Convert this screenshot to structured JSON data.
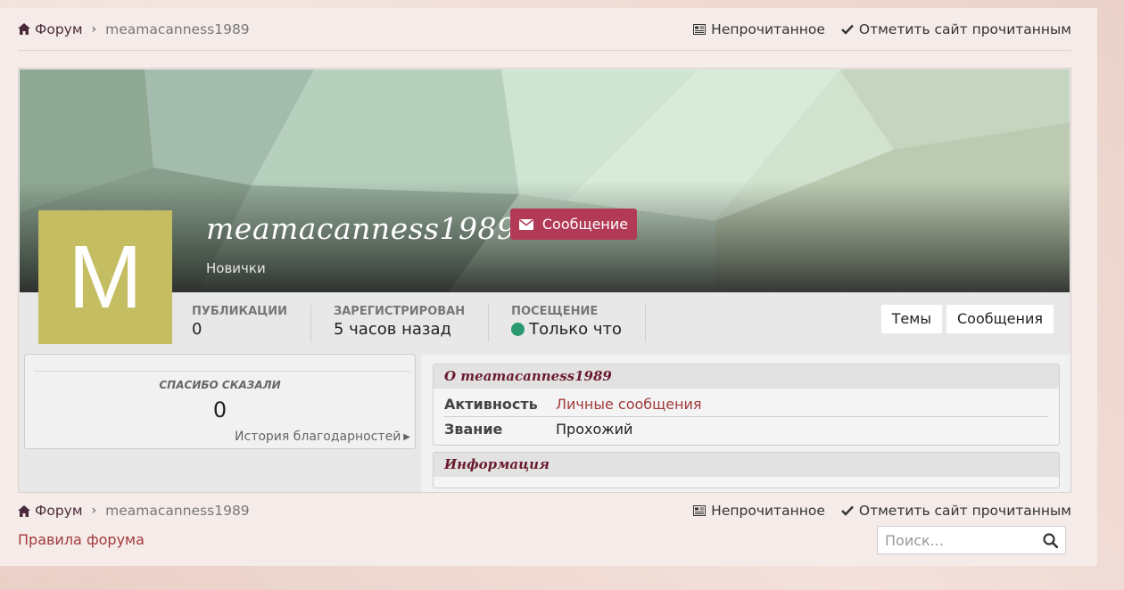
{
  "breadcrumb": {
    "home": "Форум",
    "current": "meamacanness1989"
  },
  "links": {
    "unread": "Непрочитанное",
    "mark_read": "Отметить сайт прочитанным"
  },
  "profile": {
    "avatar_letter": "M",
    "avatar_color": "#c4bd62",
    "username": "meamacanness1989",
    "group": "Новички",
    "message_button": "Сообщение",
    "stats": [
      {
        "label": "Публикации",
        "value": "0"
      },
      {
        "label": "Зарегистрирован",
        "value": "5 часов назад"
      },
      {
        "label": "Посещение",
        "value": "Только что"
      }
    ],
    "tabs": [
      "Темы",
      "Сообщения"
    ]
  },
  "thanks": {
    "label": "СПАСИБО СКАЗАЛИ",
    "value": "0",
    "history_link": "История благодарностей"
  },
  "about": {
    "title": "О meamacanness1989",
    "rows": [
      {
        "key": "Активность",
        "value": "Личные сообщения"
      },
      {
        "key": "Звание",
        "value": "Прохожий"
      }
    ]
  },
  "info": {
    "title": "Информация"
  },
  "footer": {
    "rules": "Правила форума",
    "search_placeholder": "Поиск..."
  }
}
